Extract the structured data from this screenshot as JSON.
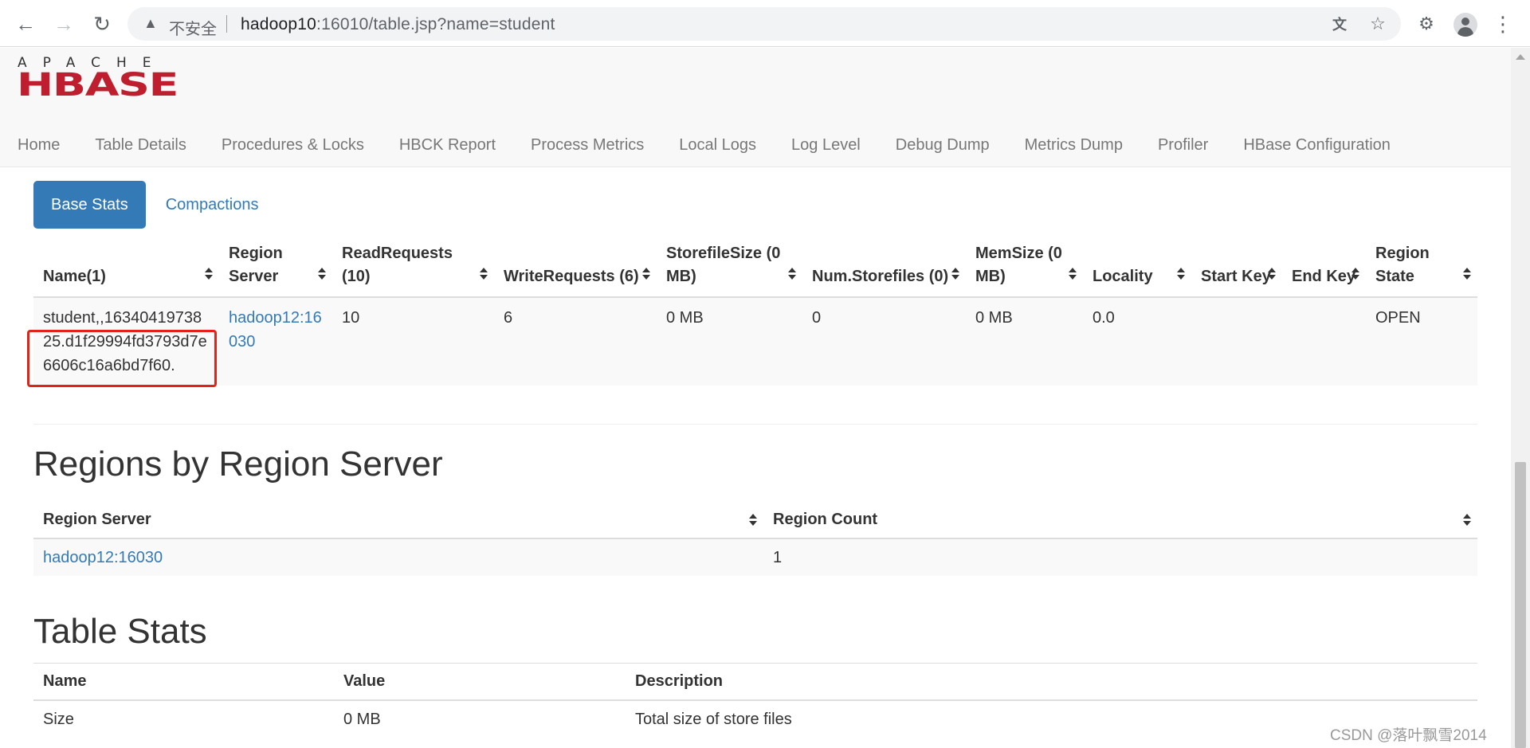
{
  "browser": {
    "insecure_label": "不安全",
    "url_host": "hadoop10",
    "url_rest": ":16010/table.jsp?name=student"
  },
  "logo": {
    "top": "APACHE",
    "main": "HBASE",
    "color": "#be1e2d"
  },
  "nav": [
    "Home",
    "Table Details",
    "Procedures & Locks",
    "HBCK Report",
    "Process Metrics",
    "Local Logs",
    "Log Level",
    "Debug Dump",
    "Metrics Dump",
    "Profiler",
    "HBase Configuration"
  ],
  "tabs": {
    "active": "Base Stats",
    "other": "Compactions"
  },
  "regions_table": {
    "headers": {
      "name": "Name(1)",
      "server": "Region Server",
      "read": "ReadRequests (10)",
      "write": "WriteRequests (6)",
      "storefile_size": "StorefileSize (0 MB)",
      "num_storefiles": "Num.Storefiles (0)",
      "memsize": "MemSize (0 MB)",
      "locality": "Locality",
      "start_key": "Start Key",
      "end_key": "End Key",
      "state": "Region State"
    },
    "row": {
      "name": "student,,1634041973825.d1f29994fd3793d7e6606c16a6bd7f60.",
      "server": "hadoop12:16030",
      "read": "10",
      "write": "6",
      "storefile_size": "0 MB",
      "num_storefiles": "0",
      "memsize": "0 MB",
      "locality": "0.0",
      "start_key": "",
      "end_key": "",
      "state": "OPEN"
    }
  },
  "regions_by_server": {
    "title": "Regions by Region Server",
    "headers": {
      "server": "Region Server",
      "count": "Region Count"
    },
    "row": {
      "server": "hadoop12:16030",
      "count": "1"
    }
  },
  "table_stats": {
    "title": "Table Stats",
    "headers": {
      "name": "Name",
      "value": "Value",
      "description": "Description"
    },
    "row": {
      "name": "Size",
      "value": "0 MB",
      "description": "Total size of store files"
    }
  },
  "watermark": "CSDN @落叶飘雪2014"
}
